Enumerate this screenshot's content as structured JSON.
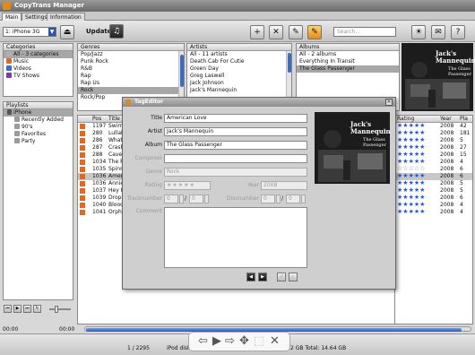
{
  "app": {
    "title": "CopyTrans Manager"
  },
  "tabs": [
    "Main",
    "Settings",
    "Information"
  ],
  "toolbar": {
    "device": "1: iPhone 3G",
    "update_label": "Update",
    "search_placeholder": "Search..."
  },
  "categories": {
    "header": "Categories",
    "items": [
      {
        "label": "All - 3 categories",
        "color": "#b0b0b0"
      },
      {
        "label": "Music",
        "color": "#e2681b"
      },
      {
        "label": "Videos",
        "color": "#3a6bd0"
      },
      {
        "label": "TV Shows",
        "color": "#7a3ab0"
      }
    ]
  },
  "genres": {
    "header": "Genres",
    "items": [
      "Pop/Jazz",
      "Punk Rock",
      "R&B",
      "Rap",
      "Rap Us",
      "Rock",
      "Rock/Pop"
    ],
    "selected": "Rock"
  },
  "artists": {
    "header": "Artists",
    "items": [
      "All - 11 artists",
      "Death Cab For Cutie",
      "Green Day",
      "Greg Laswell",
      "Jack Johnson",
      "Jack's Mannequin"
    ]
  },
  "albums": {
    "header": "Albums",
    "items": [
      "All - 2 albums",
      "Everything In Transit",
      "The Glass Passenger"
    ],
    "selected": "The Glass Passenger"
  },
  "album_art": {
    "artist": "Jack's Mannequin",
    "title": "The Glass Passenger"
  },
  "playlists": {
    "header": "Playlists",
    "device": "iPhone",
    "items": [
      "Recently Added",
      "90's",
      "Favorites",
      "Party"
    ]
  },
  "tracks": {
    "columns": [
      "Pos",
      "Title"
    ],
    "rows": [
      {
        "pos": "1197",
        "title": "Swim"
      },
      {
        "pos": "280",
        "title": "Lullab"
      },
      {
        "pos": "286",
        "title": "What"
      },
      {
        "pos": "287",
        "title": "Crash"
      },
      {
        "pos": "288",
        "title": "Caves"
      },
      {
        "pos": "1034",
        "title": "The R"
      },
      {
        "pos": "1035",
        "title": "Spinn"
      },
      {
        "pos": "1036",
        "title": "Amer"
      },
      {
        "pos": "1036",
        "title": "Annie"
      },
      {
        "pos": "1037",
        "title": "Hey H"
      },
      {
        "pos": "1039",
        "title": "Drop"
      },
      {
        "pos": "1040",
        "title": "Blood"
      },
      {
        "pos": "1041",
        "title": "Orpha"
      }
    ]
  },
  "right_table": {
    "columns": [
      "Rating",
      "Year",
      "Pla"
    ],
    "rows": [
      {
        "rating": 5,
        "year": "2008",
        "plays": "42"
      },
      {
        "rating": 5,
        "year": "2008",
        "plays": "181"
      },
      {
        "rating": 5,
        "year": "2008",
        "plays": "5"
      },
      {
        "rating": 5,
        "year": "2008",
        "plays": "27"
      },
      {
        "rating": 5,
        "year": "2008",
        "plays": "15"
      },
      {
        "rating": 5,
        "year": "2008",
        "plays": "4"
      },
      {
        "rating": 0,
        "year": "2008",
        "plays": "6"
      },
      {
        "rating": 5,
        "year": "2008",
        "plays": "6"
      },
      {
        "rating": 5,
        "year": "2008",
        "plays": "5"
      },
      {
        "rating": 5,
        "year": "2008",
        "plays": "5"
      },
      {
        "rating": 5,
        "year": "2008",
        "plays": "6"
      },
      {
        "rating": 5,
        "year": "2008",
        "plays": "4"
      },
      {
        "rating": 5,
        "year": "2008",
        "plays": "4"
      }
    ]
  },
  "tageditor": {
    "title": "TagEditor",
    "title_label": "Title",
    "title_value": "American Love",
    "artist_label": "Artist",
    "artist_value": "Jack's Mannequin",
    "album_label": "Album",
    "album_value": "The Glass Passenger",
    "composer_label": "Composer",
    "composer_value": "",
    "genre_label": "Genre",
    "genre_value": "Rock",
    "rating_label": "Rating",
    "year_label": "Year",
    "year_value": "2008",
    "track_label": "Tracknumber",
    "track_value": "0",
    "track_of": "0",
    "disc_label": "Discnumber",
    "disc_value": "0",
    "disc_of": "0",
    "comment_label": "Comment",
    "of_sep": "/"
  },
  "player": {
    "time_left": "00:00",
    "time_right": "00:00"
  },
  "status": {
    "count": "1 / 2295",
    "disk_label": "iPod disk",
    "space": "2 GB Total: 14.64 GB"
  },
  "player_progress": 0.98
}
